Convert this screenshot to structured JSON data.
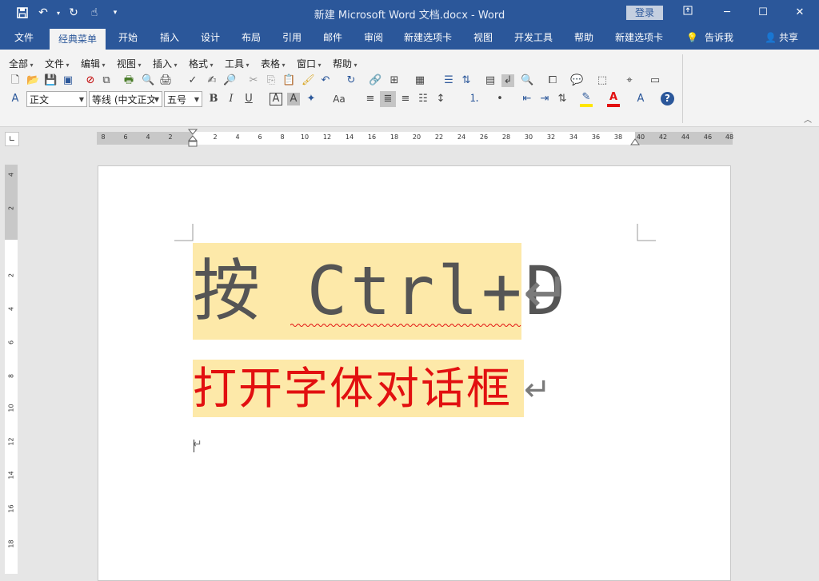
{
  "titlebar": {
    "doc_title": "新建 Microsoft Word 文档.docx  -  Word",
    "login_label": "登录",
    "qat_icons": [
      "save-icon",
      "undo-icon",
      "redo-icon",
      "touch-mode-icon",
      "customize-qat-icon"
    ]
  },
  "tabs": [
    {
      "label": "文件"
    },
    {
      "label": "经典菜单"
    },
    {
      "label": "开始"
    },
    {
      "label": "插入"
    },
    {
      "label": "设计"
    },
    {
      "label": "布局"
    },
    {
      "label": "引用"
    },
    {
      "label": "邮件"
    },
    {
      "label": "审阅"
    },
    {
      "label": "新建选项卡"
    },
    {
      "label": "视图"
    },
    {
      "label": "开发工具"
    },
    {
      "label": "帮助"
    },
    {
      "label": "新建选项卡"
    }
  ],
  "tell_me": "告诉我",
  "share": "共享",
  "classic_menu": [
    "全部",
    "文件",
    "编辑",
    "视图",
    "插入",
    "格式",
    "工具",
    "表格",
    "窗口",
    "帮助"
  ],
  "style_box": "正文",
  "font_box": "等线 (中文正文",
  "size_box": "五号",
  "format_buttons": {
    "bold": "B",
    "italic": "I",
    "underline": "U",
    "char_border": "A",
    "char_shading": "A",
    "change_case": "Aa"
  },
  "ruler_numbers": [
    "8",
    "6",
    "4",
    "2",
    "2",
    "4",
    "6",
    "8",
    "10",
    "12",
    "14",
    "16",
    "18",
    "20",
    "22",
    "24",
    "26",
    "28",
    "30",
    "32",
    "34",
    "36",
    "38",
    "40",
    "42",
    "44",
    "46",
    "48"
  ],
  "vruler_numbers": [
    "4",
    "2",
    "2",
    "4",
    "6",
    "8",
    "10",
    "12",
    "14",
    "16",
    "18"
  ],
  "document": {
    "line1": "按 Ctrl+D",
    "line2": "打开字体对话框"
  },
  "colors": {
    "accent": "#2b579a",
    "highlight": "#fde9a9",
    "font_red": "#e21010"
  }
}
